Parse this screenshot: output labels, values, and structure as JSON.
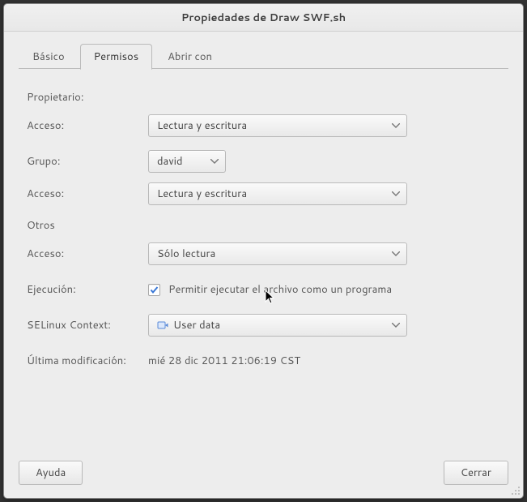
{
  "window": {
    "title": "Propiedades de Draw SWF.sh"
  },
  "tabs": {
    "basic": "Básico",
    "permissions": "Permisos",
    "open_with": "Abrir con"
  },
  "labels": {
    "owner": "Propietario:",
    "access": "Acceso:",
    "group": "Grupo:",
    "others": "Otros",
    "execution": "Ejecución:",
    "selinux": "SELinux Context:",
    "last_mod": "Última modificación:"
  },
  "values": {
    "owner_access": "Lectura y escritura",
    "group_name": "david",
    "group_access": "Lectura y escritura",
    "others_access": "Sólo lectura",
    "exec_label": "Permitir ejecutar el archivo como un programa",
    "selinux_value": "User data",
    "last_mod_value": "mié 28 dic 2011 21:06:19 CST"
  },
  "buttons": {
    "help": "Ayuda",
    "close": "Cerrar"
  }
}
